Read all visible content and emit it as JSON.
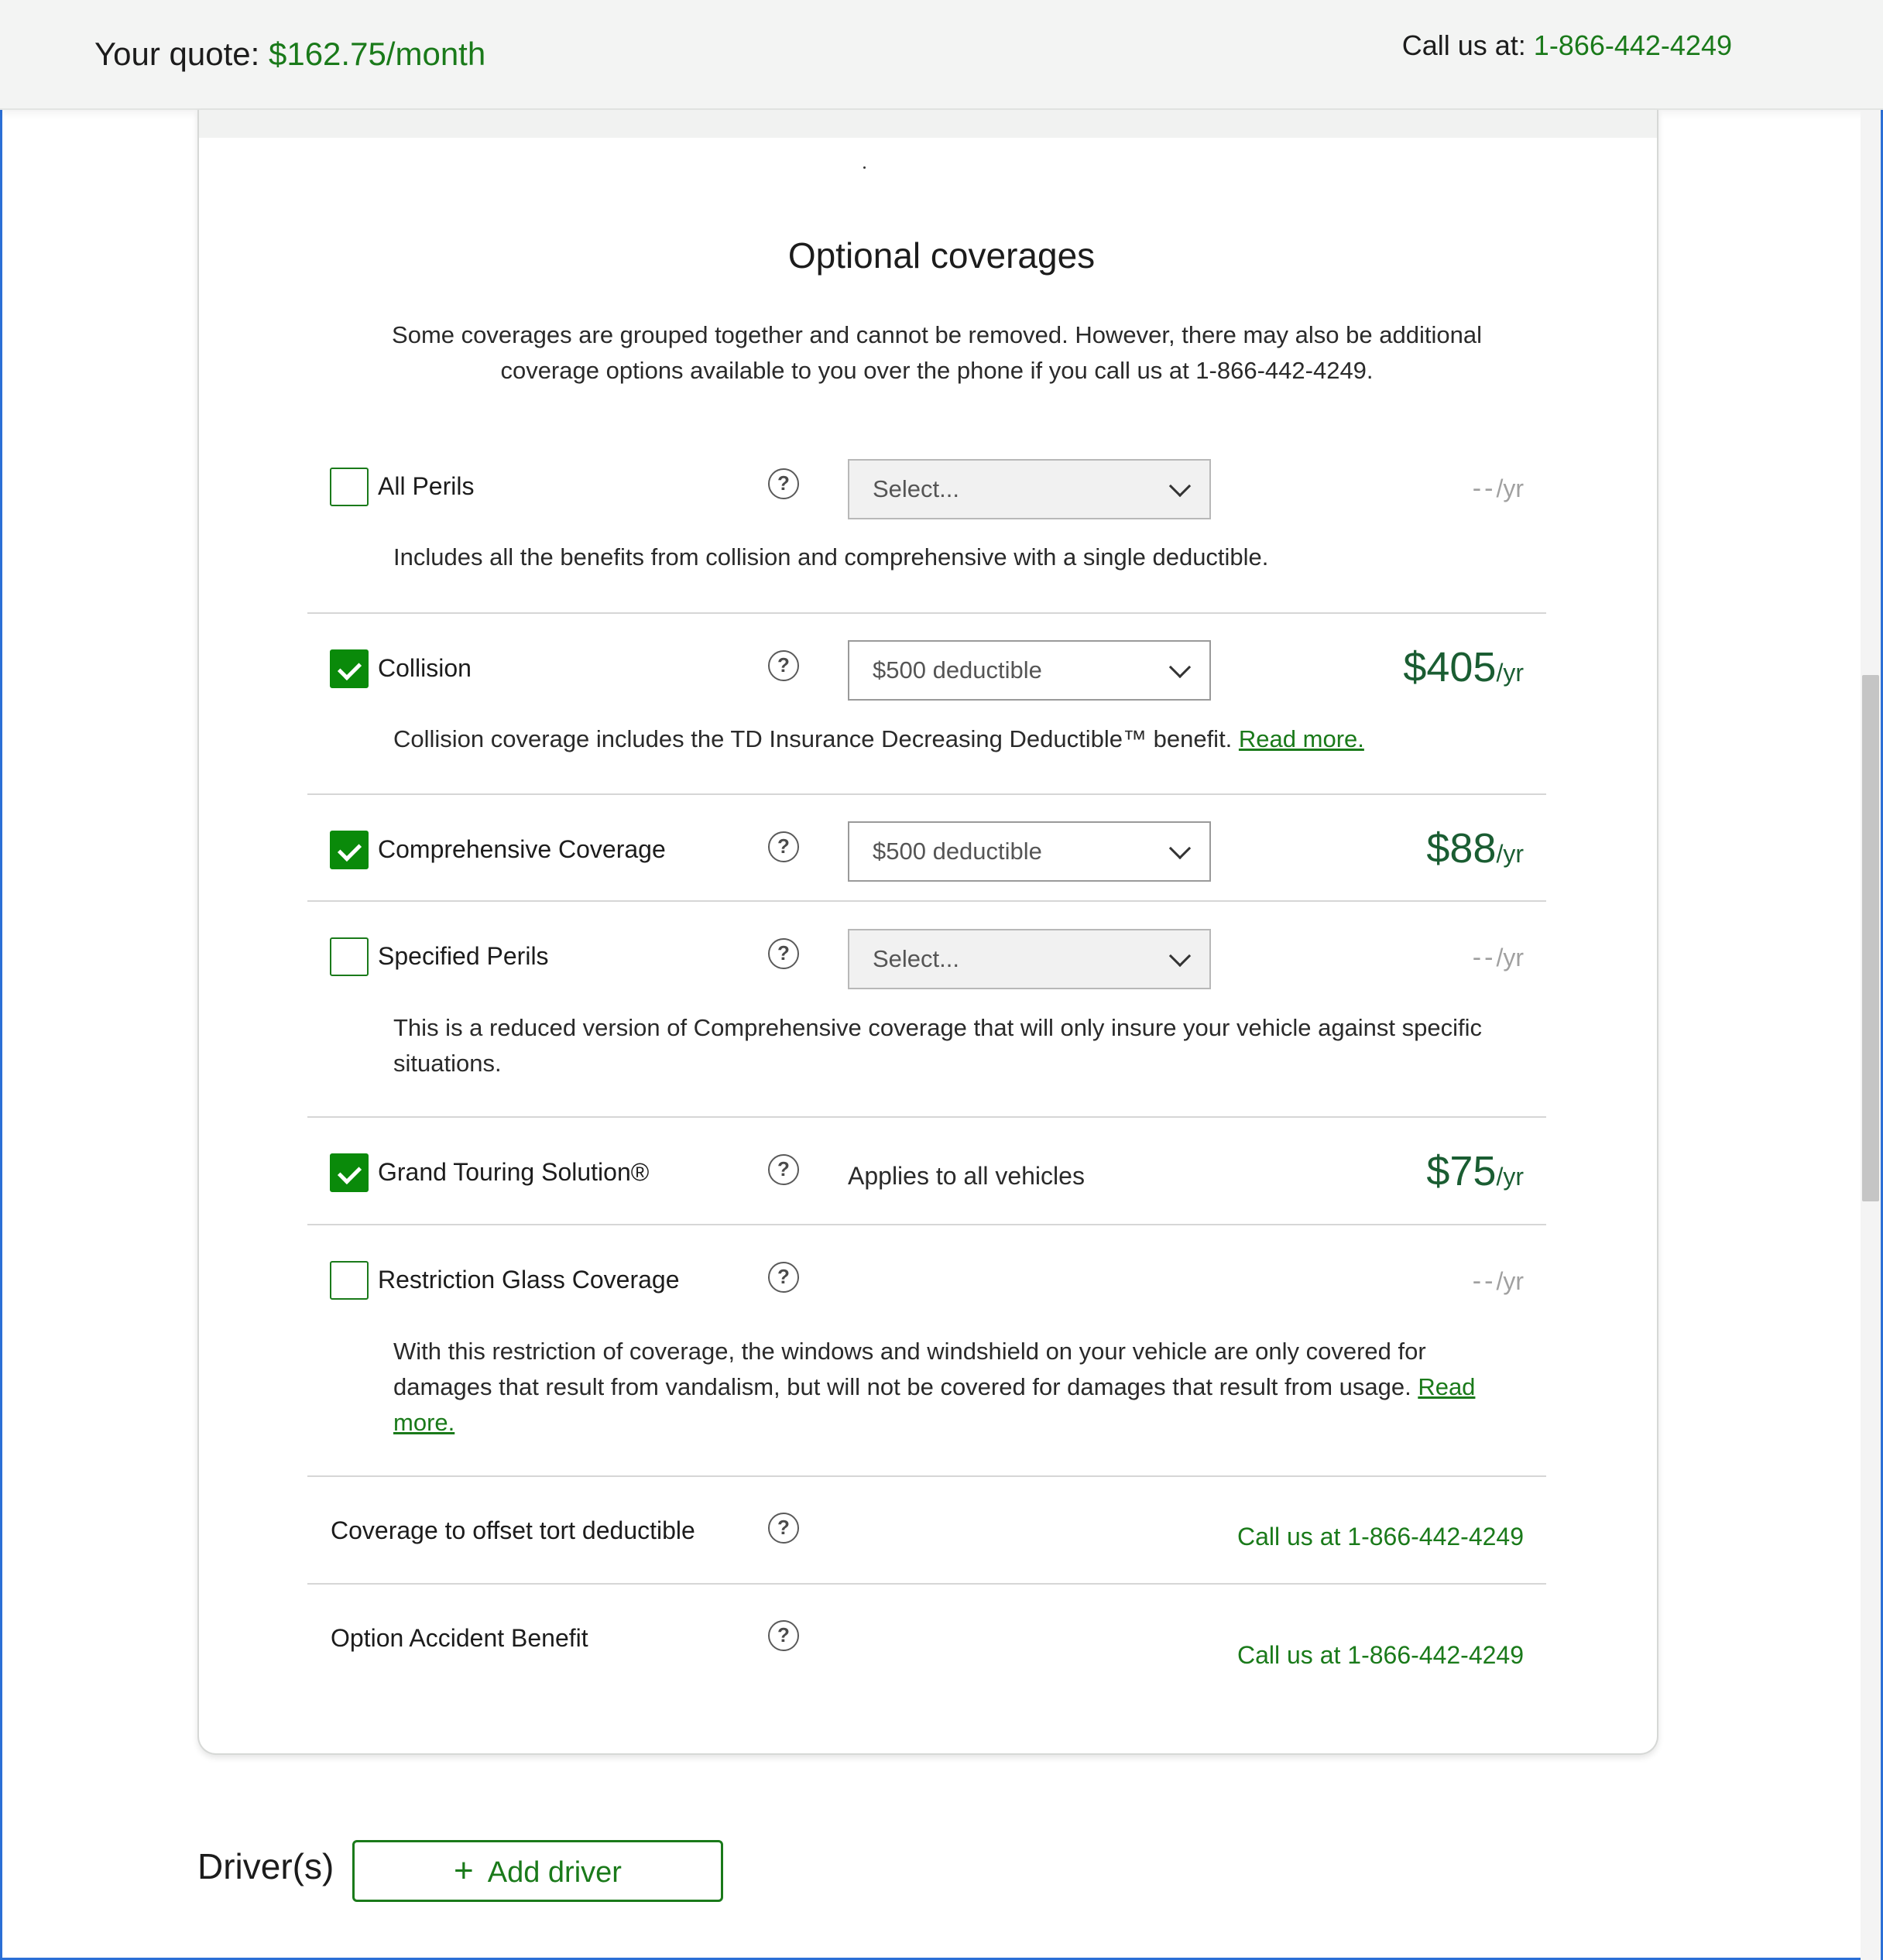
{
  "header": {
    "quote_label": "Your quote: ",
    "quote_amount": "$162.75/month",
    "call_label": "Call us at: ",
    "call_number": "1-866-442-4249"
  },
  "section": {
    "title": "Optional coverages",
    "intro": "Some coverages are grouped together and cannot be removed. However, there may also be additional coverage options available to you over the phone if you call us at 1-866-442-4249."
  },
  "coverages": [
    {
      "label": "All Perils",
      "checked": false,
      "select": "Select...",
      "price": "--",
      "unit": "/yr",
      "desc": "Includes all the benefits from collision and comprehensive with a single deductible."
    },
    {
      "label": "Collision",
      "checked": true,
      "select": "$500 deductible",
      "price": "$405",
      "unit": "/yr",
      "desc": "Collision coverage includes the TD Insurance Decreasing Deductible™ benefit. ",
      "link": "Read more."
    },
    {
      "label": "Comprehensive Coverage",
      "checked": true,
      "select": "$500 deductible",
      "price": "$88",
      "unit": "/yr"
    },
    {
      "label": "Specified Perils",
      "checked": false,
      "select": "Select...",
      "price": "--",
      "unit": "/yr",
      "desc": "This is a reduced version of Comprehensive coverage that will only insure your vehicle against specific situations."
    },
    {
      "label": "Grand Touring Solution®",
      "checked": true,
      "applies": "Applies to all vehicles",
      "price": "$75",
      "unit": "/yr"
    },
    {
      "label": "Restriction Glass Coverage",
      "checked": false,
      "price": "--",
      "unit": "/yr",
      "desc": "With this restriction of coverage, the windows and windshield on your vehicle are only covered for damages that result from vandalism, but will not be covered for damages that result from usage. ",
      "link": "Read more."
    },
    {
      "label": "Coverage to offset tort deductible",
      "call_label": "Call us at ",
      "call_number": "1-866-442-4249"
    },
    {
      "label": "Option Accident Benefit",
      "call_label": "Call us at ",
      "call_number": "1-866-442-4249"
    }
  ],
  "help_glyph": "?",
  "drivers": {
    "title": "Driver(s)",
    "add_label": "Add driver",
    "add_icon": "+"
  },
  "colors": {
    "accent": "#1a7a1a",
    "price": "#1a5d32",
    "checkbox_on": "#0a8a0a"
  }
}
